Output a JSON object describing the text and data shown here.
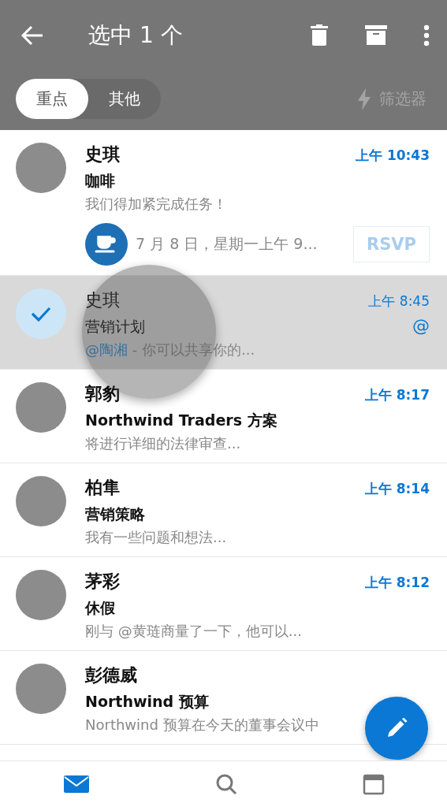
{
  "app_bar": {
    "title": "选中 1 个"
  },
  "tabs": [
    {
      "label": "重点",
      "selected": true
    },
    {
      "label": "其他",
      "selected": false
    }
  ],
  "filter": {
    "label": "筛选器"
  },
  "messages": [
    {
      "sender": "史琪",
      "subject": "咖啡",
      "preview": "我们得加紧完成任务！",
      "time": "上午 10:43",
      "unread": true,
      "selected": false,
      "event": {
        "text": "7 月 8 日，星期一上午 9...",
        "button": "RSVP"
      }
    },
    {
      "sender": "史琪",
      "subject": "营销计划",
      "mention": "@陶湘",
      "preview": " - 你可以共享你的...",
      "time": "上午 8:45",
      "at_mark": "@",
      "unread": false,
      "selected": true
    },
    {
      "sender": "郭豹",
      "subject": "Northwind Traders 方案",
      "preview": "将进行详细的法律审查...",
      "time": "上午 8:17",
      "unread": true,
      "selected": false
    },
    {
      "sender": "柏隼",
      "subject": "营销策略",
      "preview": "我有一些问题和想法...",
      "time": "上午 8:14",
      "unread": true,
      "selected": false
    },
    {
      "sender": "茅彩",
      "subject": "休假",
      "preview": "刚与 @黄琏商量了一下，他可以...",
      "time": "上午 8:12",
      "unread": true,
      "selected": false
    },
    {
      "sender": "彭德威",
      "subject": "Northwind 预算",
      "preview": "Northwind 预算在今天的董事会议中",
      "unread": true,
      "selected": false
    }
  ]
}
